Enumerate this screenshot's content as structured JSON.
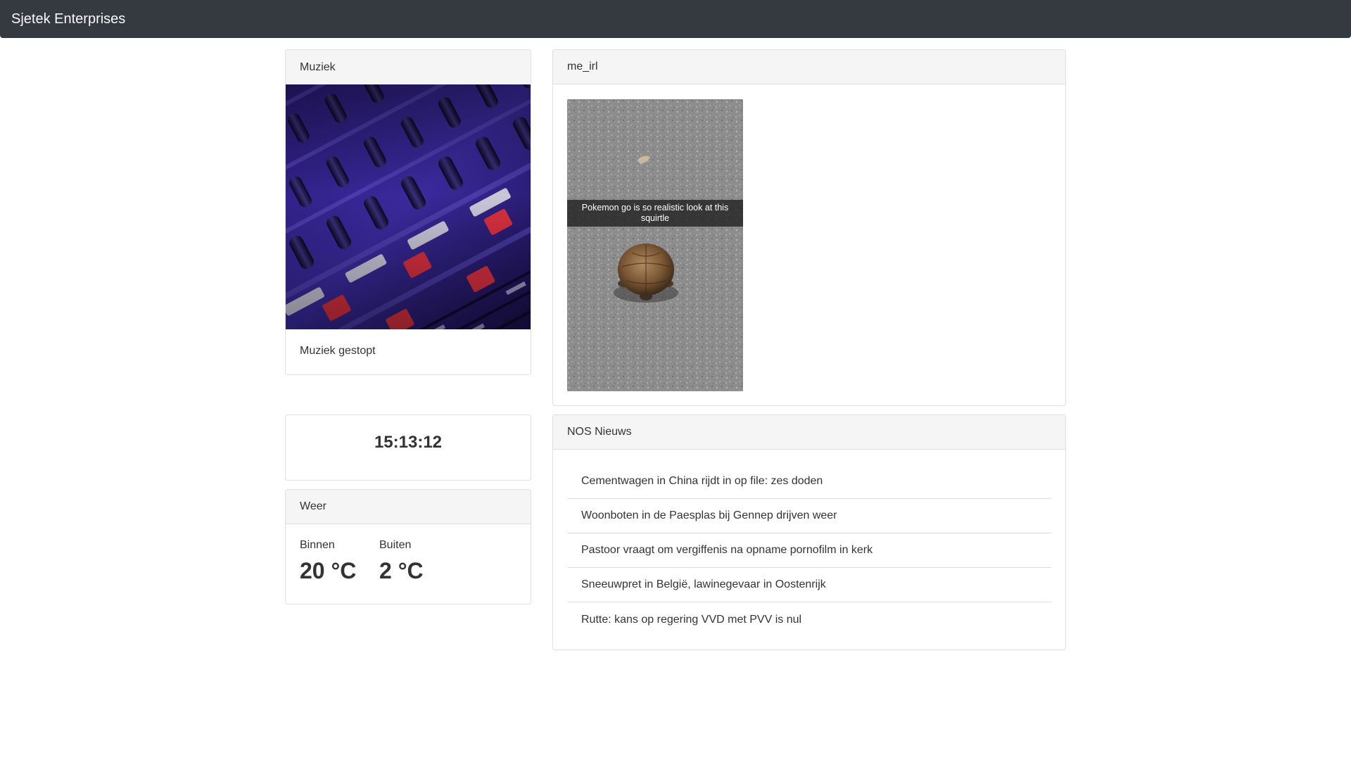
{
  "navbar": {
    "brand": "Sjetek Enterprises"
  },
  "muziek": {
    "title": "Muziek",
    "image": "mixing-console-photo",
    "status": "Muziek gestopt"
  },
  "meirl": {
    "title": "me_irl",
    "image": "turtle-on-asphalt-photo",
    "caption": "Pokemon go is so realistic look at this squirtle"
  },
  "clock": {
    "time": "15:13:12"
  },
  "weer": {
    "title": "Weer",
    "binnen_label": "Binnen",
    "binnen_value": "20 °C",
    "buiten_label": "Buiten",
    "buiten_value": "2 °C"
  },
  "nos": {
    "title": "NOS Nieuws",
    "items": [
      "Cementwagen in China rijdt in op file: zes doden",
      "Woonboten in de Paesplas bij Gennep drijven weer",
      "Pastoor vraagt om vergiffenis na opname pornofilm in kerk",
      "Sneeuwpret in België, lawinegevaar in Oostenrijk",
      "Rutte: kans op regering VVD met PVV is nul"
    ]
  }
}
